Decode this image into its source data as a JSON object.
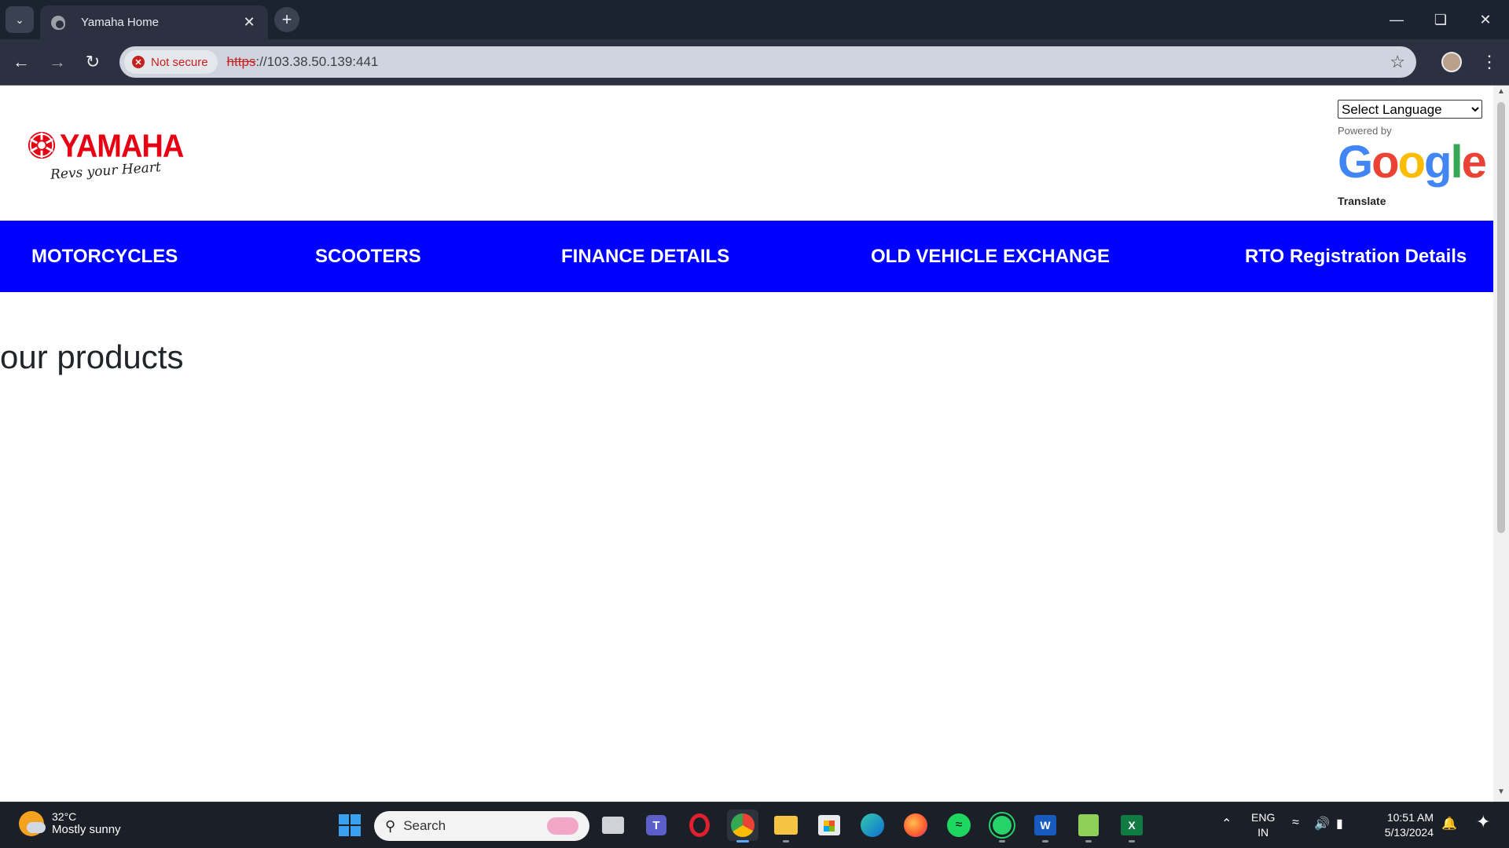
{
  "browser": {
    "tab_title": "Yamaha Home",
    "security_label": "Not secure",
    "url_scheme": "https",
    "url_rest": "://103.38.50.139:441"
  },
  "page": {
    "logo": {
      "brand": "YAMAHA",
      "tagline": "Revs your Heart"
    },
    "translate": {
      "select_label": "Select Language",
      "powered_by": "Powered by",
      "google": "Google",
      "translate_label": "Translate"
    },
    "nav": {
      "items": [
        {
          "label": "MOTORCYCLES"
        },
        {
          "label": "SCOOTERS"
        },
        {
          "label": "FINANCE DETAILS"
        },
        {
          "label": "OLD VEHICLE EXCHANGE"
        },
        {
          "label": "RTO Registration Details"
        }
      ],
      "bg_color": "#0000ff"
    },
    "section_heading": "our products"
  },
  "taskbar": {
    "weather_temp": "32°C",
    "weather_desc": "Mostly sunny",
    "search_placeholder": "Search",
    "lang_line1": "ENG",
    "lang_line2": "IN",
    "time": "10:51 AM",
    "date": "5/13/2024",
    "apps": [
      "task-view",
      "teams",
      "opera",
      "chrome",
      "file-explorer",
      "microsoft-store",
      "edge",
      "firefox",
      "spotify",
      "whatsapp",
      "word",
      "notepad",
      "excel"
    ]
  }
}
